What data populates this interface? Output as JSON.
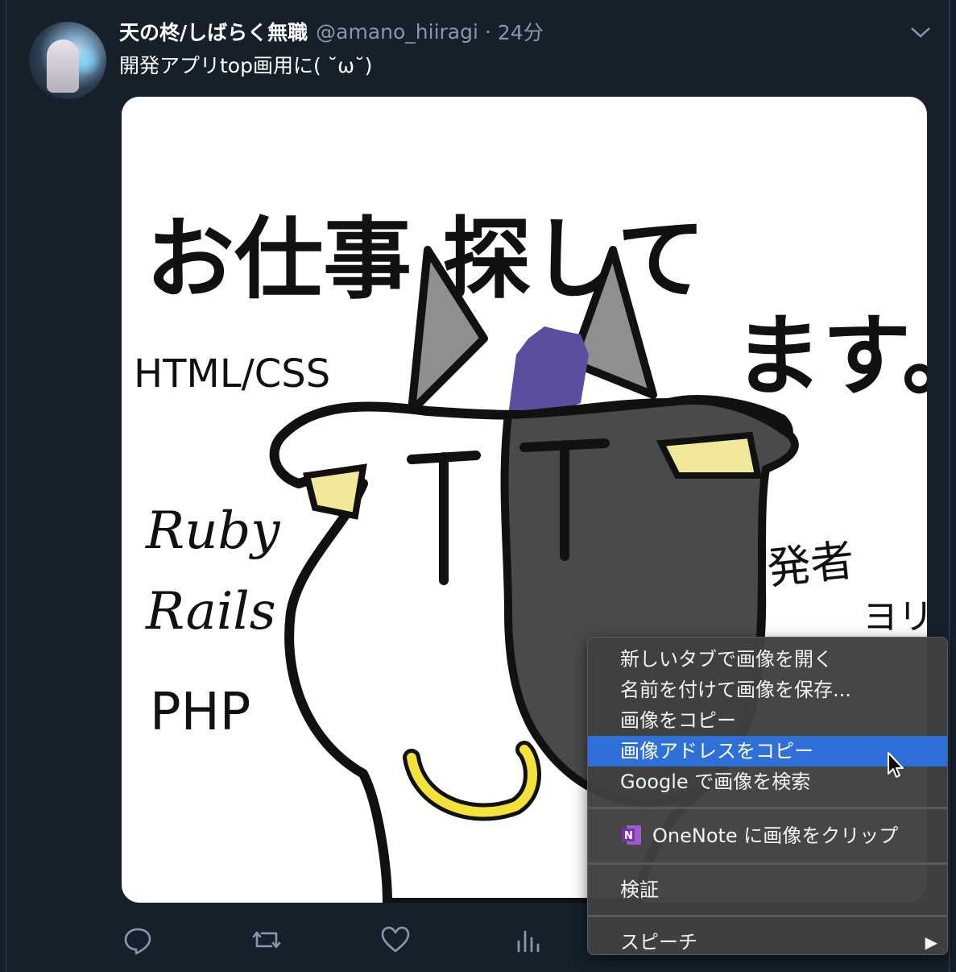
{
  "tweet": {
    "display_name": "天の柊/しばらく無職",
    "handle": "@amano_hiiragi",
    "separator": "·",
    "time": "24分",
    "text": "開発アプリtop画用に( ˘ω˘)"
  },
  "image": {
    "title_line1": "お仕事 探して",
    "title_line2": "ます。",
    "skill_html_css": "HTML/CSS",
    "skill_ruby": "Ruby",
    "skill_rails": "Rails",
    "skill_php": "PHP",
    "signature_line1": "開発者",
    "signature_line2": "ヨリ。"
  },
  "actions": {
    "icons": [
      "reply-icon",
      "retweet-icon",
      "like-icon",
      "analytics-icon"
    ]
  },
  "context_menu": {
    "items": [
      "新しいタブで画像を開く",
      "名前を付けて画像を保存...",
      "画像をコピー",
      "画像アドレスをコピー",
      "Google で画像を検索"
    ],
    "highlighted_index": 3,
    "onenote": "OneNote に画像をクリップ",
    "inspect": "検証",
    "speech": "スピーチ",
    "submenu_arrow": "▶",
    "highlight_color": "#2f6fd8"
  }
}
